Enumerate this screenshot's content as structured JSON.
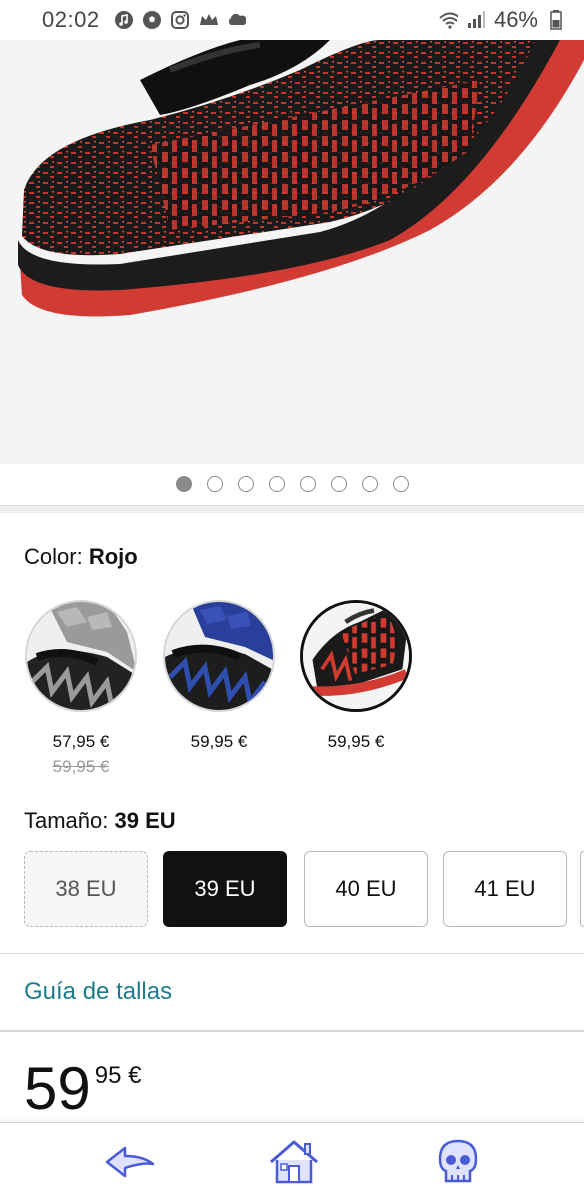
{
  "status_bar": {
    "time": "02:02",
    "battery": "46%",
    "left_icons": [
      "music-icon",
      "soccer-ball-icon",
      "instagram-icon",
      "crown-icon",
      "cloud-icon"
    ],
    "right_icons": [
      "wifi-icon",
      "signal-icon",
      "battery-icon"
    ]
  },
  "gallery": {
    "image_count": 8,
    "active_index": 0
  },
  "color": {
    "label": "Color:",
    "selected": "Rojo",
    "options": [
      {
        "name": "gris",
        "price": "57,95 €",
        "old_price": "59,95 €",
        "accent": "#8c8c8c"
      },
      {
        "name": "azul",
        "price": "59,95 €",
        "accent": "#2a3f9a"
      },
      {
        "name": "rojo",
        "price": "59,95 €",
        "accent": "#d9332a"
      }
    ]
  },
  "size": {
    "label": "Tamaño:",
    "selected": "39 EU",
    "options": [
      "38 EU",
      "39 EU",
      "40 EU",
      "41 EU"
    ]
  },
  "size_guide": "Guía de tallas",
  "price": {
    "integer": "59",
    "decimal": "95 €"
  },
  "nav": {
    "icons": [
      "back-arrow-icon",
      "home-icon",
      "skull-icon"
    ],
    "accent": "#4a5bd8"
  },
  "colors": {
    "link": "#1c7c8a",
    "shoe_red": "#d9332a",
    "sole_red": "#d23b34"
  }
}
